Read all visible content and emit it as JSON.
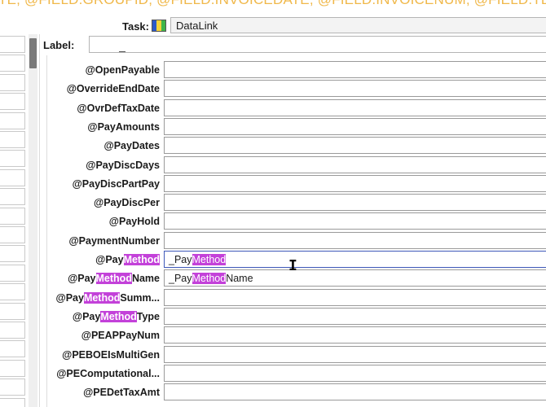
{
  "background_text": "TE, @FIELD.GROUPID, @FIELD.INVOICEDATE, @FIELD.INVOICENUM, @FIELD.TERMSCODE, @",
  "highlight_term": "Method",
  "colors": {
    "highlight": "#c341d9",
    "focus_border": "#3e58b8",
    "background_text": "#f0b84a"
  },
  "task": {
    "label": "Task:",
    "value": "DataLink",
    "icon": "datalink-icon"
  },
  "label_field": {
    "label": "Label:",
    "value": ""
  },
  "params": [
    {
      "label": "@OpenPayable",
      "value": ""
    },
    {
      "label": "@OverrideEndDate",
      "value": ""
    },
    {
      "label": "@OvrDefTaxDate",
      "value": ""
    },
    {
      "label": "@PayAmounts",
      "value": ""
    },
    {
      "label": "@PayDates",
      "value": ""
    },
    {
      "label": "@PayDiscDays",
      "value": ""
    },
    {
      "label": "@PayDiscPartPay",
      "value": ""
    },
    {
      "label": "@PayDiscPer",
      "value": ""
    },
    {
      "label": "@PayHold",
      "value": ""
    },
    {
      "label": "@PaymentNumber",
      "value": ""
    },
    {
      "label": "@PayMethod",
      "value": "_PayMethod",
      "focused": true
    },
    {
      "label": "@PayMethodName",
      "value": "_PayMethodName"
    },
    {
      "label": "@PayMethodSumm...",
      "value": ""
    },
    {
      "label": "@PayMethodType",
      "value": ""
    },
    {
      "label": "@PEAPPayNum",
      "value": ""
    },
    {
      "label": "@PEBOEIsMultiGen",
      "value": ""
    },
    {
      "label": "@PEComputational...",
      "value": ""
    },
    {
      "label": "@PEDetTaxAmt",
      "value": ""
    }
  ]
}
